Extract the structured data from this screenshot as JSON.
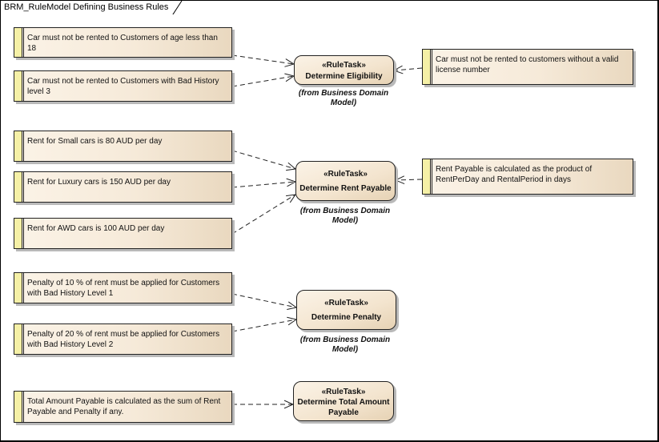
{
  "diagram": {
    "title": "BRM_RuleModel Defining Business Rules"
  },
  "tasks": [
    {
      "stereotype": "«RuleTask»",
      "name": "Determine Eligibility",
      "from": "(from Business Domain Model)"
    },
    {
      "stereotype": "«RuleTask»",
      "name": "Determine Rent Payable",
      "from": "(from Business Domain Model)"
    },
    {
      "stereotype": "«RuleTask»",
      "name": "Determine Penalty",
      "from": "(from Business Domain Model)"
    },
    {
      "stereotype": "«RuleTask»",
      "name": "Determine Total Amount Payable",
      "from": ""
    }
  ],
  "rules": [
    {
      "text": "Car must not be rented to Customers of age less than 18",
      "target": 0
    },
    {
      "text": "Car must not be rented to Customers with Bad History level 3",
      "target": 0
    },
    {
      "text": "Car must not be rented to customers without a valid license number",
      "target": 0
    },
    {
      "text": "Rent for Small cars is 80 AUD per day",
      "target": 1
    },
    {
      "text": "Rent for Luxury cars is 150 AUD per day",
      "target": 1
    },
    {
      "text": "Rent for AWD cars is 100 AUD per day",
      "target": 1
    },
    {
      "text": "Rent Payable is calculated as the product of RentPerDay and RentalPeriod in days",
      "target": 1
    },
    {
      "text": "Penalty of 10 % of rent must be applied for Customers with Bad History Level 1",
      "target": 2
    },
    {
      "text": "Penalty of 20 % of rent must be applied for Customers with Bad History Level 2",
      "target": 2
    },
    {
      "text": "Total Amount Payable is calculated as the sum of Rent Payable and Penalty if any.",
      "target": 3
    }
  ]
}
